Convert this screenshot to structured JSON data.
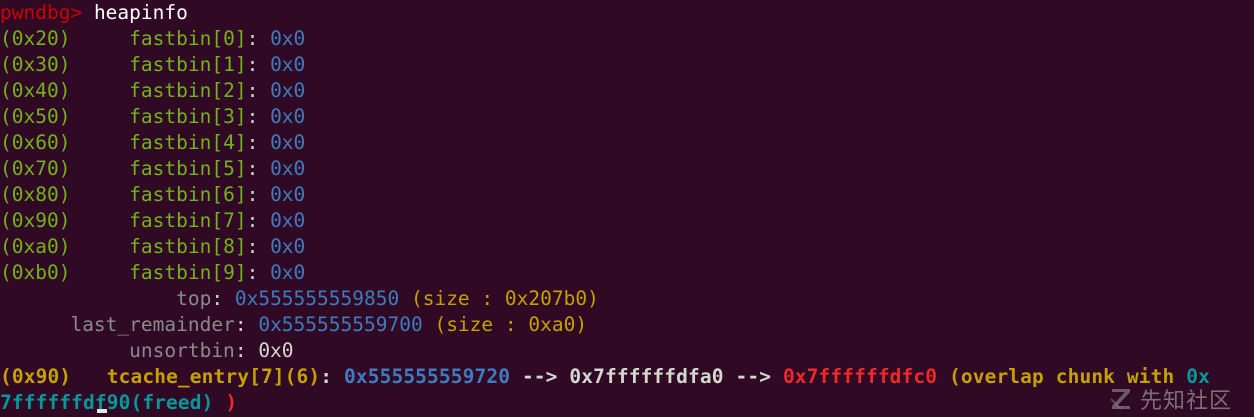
{
  "prompt": "pwndbg>",
  "command": "heapinfo",
  "fastbins": [
    {
      "size": "(0x20)",
      "label": "fastbin[0]",
      "value": "0x0"
    },
    {
      "size": "(0x30)",
      "label": "fastbin[1]",
      "value": "0x0"
    },
    {
      "size": "(0x40)",
      "label": "fastbin[2]",
      "value": "0x0"
    },
    {
      "size": "(0x50)",
      "label": "fastbin[3]",
      "value": "0x0"
    },
    {
      "size": "(0x60)",
      "label": "fastbin[4]",
      "value": "0x0"
    },
    {
      "size": "(0x70)",
      "label": "fastbin[5]",
      "value": "0x0"
    },
    {
      "size": "(0x80)",
      "label": "fastbin[6]",
      "value": "0x0"
    },
    {
      "size": "(0x90)",
      "label": "fastbin[7]",
      "value": "0x0"
    },
    {
      "size": "(0xa0)",
      "label": "fastbin[8]",
      "value": "0x0"
    },
    {
      "size": "(0xb0)",
      "label": "fastbin[9]",
      "value": "0x0"
    }
  ],
  "top": {
    "label": "top",
    "address": "0x555555559850",
    "size_info": "(size : 0x207b0)"
  },
  "last_remainder": {
    "label": "last_remainder",
    "address": "0x555555559700",
    "size_info": "(size : 0xa0)"
  },
  "unsortbin": {
    "label": "unsortbin",
    "value": "0x0"
  },
  "tcache": {
    "size": "(0x90)",
    "label": "tcache_entry[7]",
    "count": "(6)",
    "entry1": "0x555555559720",
    "arrow1": "-->",
    "entry2": "0x7ffffffdfa0",
    "arrow2": "-->",
    "entry3": "0x7ffffffdfc0",
    "overlap_text": "(overlap chunk with ",
    "overlap_addr_part1": "0x",
    "overlap_addr_part2": "7ffffffdf90(freed)",
    "close_paren": ")"
  },
  "watermark": "先知社区",
  "colors": {
    "background": "#300a24",
    "prompt": "#cc0000",
    "green": "#73b21a",
    "blue": "#3e7bbf",
    "yellow": "#c4a000",
    "red": "#ef2929",
    "teal": "#06989a",
    "gray": "#8a8a8a"
  }
}
